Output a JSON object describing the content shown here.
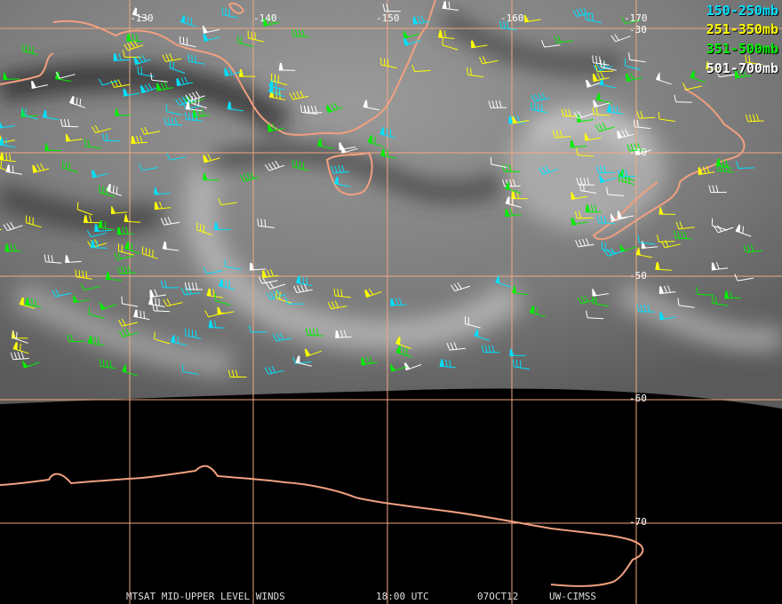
{
  "legend": [
    {
      "label": "150-250mb",
      "color": "#00e0ff"
    },
    {
      "label": "251-350mb",
      "color": "#ffff00"
    },
    {
      "label": "351-500mb",
      "color": "#00ee00"
    },
    {
      "label": "501-700mb",
      "color": "#ffffff"
    }
  ],
  "grid": {
    "longitude_labels": [
      "-130",
      "-140",
      "-150",
      "-160",
      "-170"
    ],
    "latitude_labels": [
      "-30",
      "-40",
      "-50",
      "-60",
      "-70"
    ],
    "line_color": "#f0a880"
  },
  "coastline_color": "#f0a080",
  "footer": {
    "product": "MTSAT MID-UPPER LEVEL WINDS",
    "time": "18:00 UTC",
    "date": "07OCT12",
    "source": "UW-CIMSS"
  }
}
